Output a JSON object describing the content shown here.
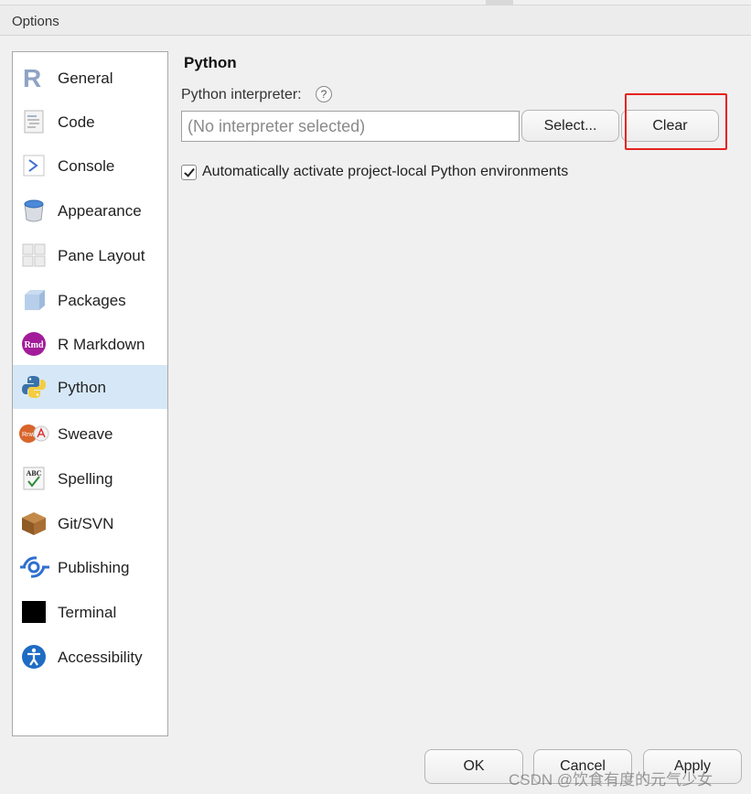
{
  "window": {
    "title": "Options"
  },
  "sidebar": {
    "items": [
      {
        "label": "General",
        "icon": "r-logo-icon"
      },
      {
        "label": "Code",
        "icon": "code-document-icon"
      },
      {
        "label": "Console",
        "icon": "console-prompt-icon"
      },
      {
        "label": "Appearance",
        "icon": "paint-bucket-icon"
      },
      {
        "label": "Pane Layout",
        "icon": "pane-layout-icon"
      },
      {
        "label": "Packages",
        "icon": "package-box-icon"
      },
      {
        "label": "R Markdown",
        "icon": "rmd-icon"
      },
      {
        "label": "Python",
        "icon": "python-logo-icon",
        "selected": true
      },
      {
        "label": "Sweave",
        "icon": "sweave-pdf-icon"
      },
      {
        "label": "Spelling",
        "icon": "abc-spelling-icon"
      },
      {
        "label": "Git/SVN",
        "icon": "git-box-icon"
      },
      {
        "label": "Publishing",
        "icon": "publishing-icon"
      },
      {
        "label": "Terminal",
        "icon": "terminal-icon"
      },
      {
        "label": "Accessibility",
        "icon": "accessibility-icon"
      }
    ]
  },
  "python": {
    "section_title": "Python",
    "interpreter_label": "Python interpreter:",
    "help_glyph": "?",
    "interpreter_placeholder": "(No interpreter selected)",
    "select_button": "Select...",
    "clear_button": "Clear",
    "auto_activate_label": "Automatically activate project-local Python environments",
    "auto_activate_checked": true
  },
  "footer": {
    "ok": "OK",
    "cancel": "Cancel",
    "apply": "Apply"
  },
  "watermark": "CSDN @饮食有度的元气少女",
  "colors": {
    "selected_bg": "#d6e8f7",
    "highlight_border": "#e5231f"
  }
}
